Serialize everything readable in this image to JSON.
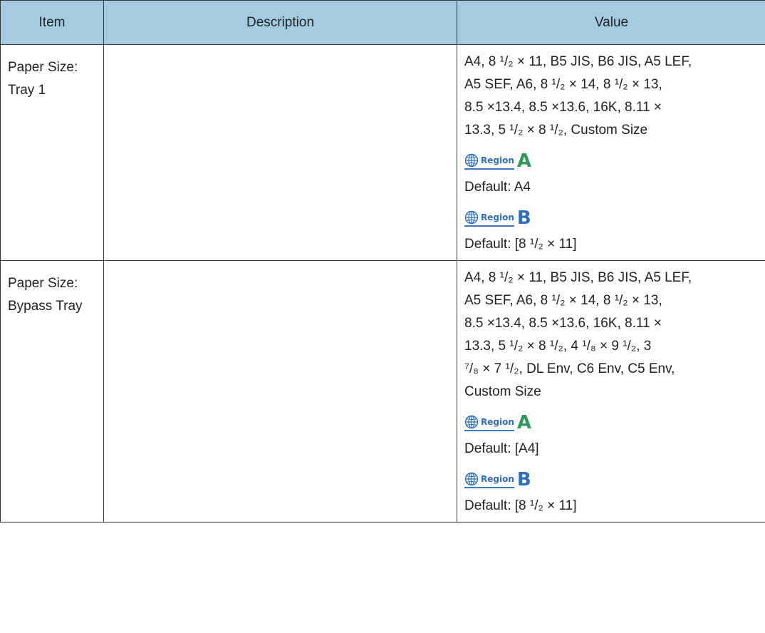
{
  "table": {
    "headers": {
      "item": "Item",
      "description": "Description",
      "value": "Value"
    },
    "rows": [
      {
        "item_lines": [
          "Paper Size:",
          "Tray 1"
        ],
        "description": "",
        "value_lines": [
          "A4, 8 ¹/₂ × 11, B5 JIS, B6 JIS, A5 LEF,",
          "A5 SEF, A6, 8 ¹/₂ × 14, 8 ¹/₂ × 13,",
          "8.5 ×13.4, 8.5 ×13.6, 16K, 8.11 ×",
          "13.3, 5 ¹/₂ × 8 ¹/₂, Custom Size"
        ],
        "region_a": {
          "label": "Region",
          "letter": "A"
        },
        "default_a": "Default: A4",
        "region_b": {
          "label": "Region",
          "letter": "B"
        },
        "default_b": "Default: [8 ¹/₂ × 11]"
      },
      {
        "item_lines": [
          "Paper Size:",
          "Bypass Tray"
        ],
        "description": "",
        "value_lines": [
          "A4, 8 ¹/₂ × 11, B5 JIS, B6 JIS, A5 LEF,",
          "A5 SEF, A6, 8 ¹/₂ × 14, 8 ¹/₂ × 13,",
          "8.5 ×13.4, 8.5 ×13.6, 16K, 8.11 ×",
          "13.3, 5 ¹/₂ × 8 ¹/₂, 4 ¹/₈ × 9 ¹/₂, 3",
          "⁷/₈ × 7 ¹/₂, DL Env, C6 Env, C5 Env,",
          "Custom Size"
        ],
        "region_a": {
          "label": "Region",
          "letter": "A"
        },
        "default_a": "Default: [A4]",
        "region_b": {
          "label": "Region",
          "letter": "B"
        },
        "default_b": "Default: [8 ¹/₂ × 11]"
      }
    ]
  },
  "colors": {
    "header_bg": "#a4cce0",
    "region_a_letter": "#2e9a5a",
    "region_b_letter": "#2f6fba",
    "region_label": "#2f6fba"
  },
  "icons": {
    "region": "globe-icon"
  }
}
